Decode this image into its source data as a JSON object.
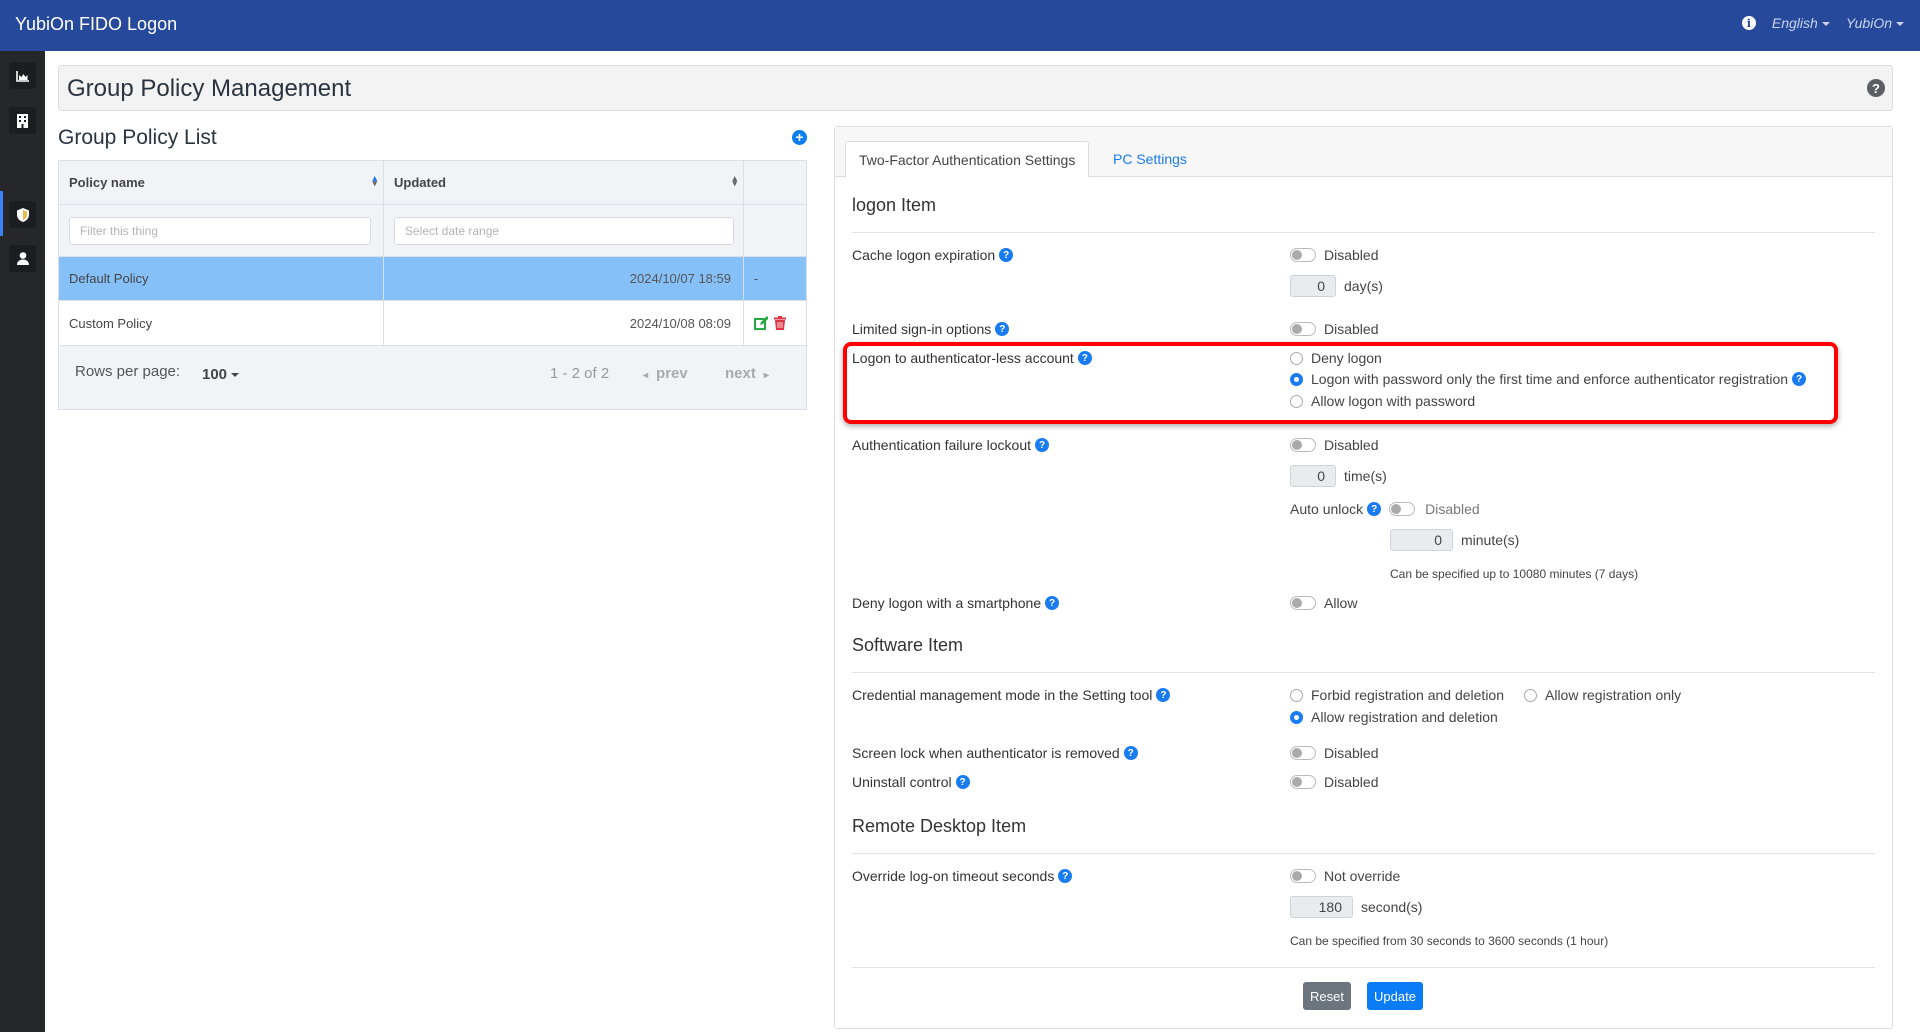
{
  "header": {
    "app_title": "YubiOn FIDO Logon",
    "language": "English",
    "user": "YubiOn",
    "info_icon": "info-circle-icon"
  },
  "sidebar": {
    "items": [
      {
        "icon": "chart-area-icon",
        "label": "Dashboard"
      },
      {
        "icon": "building-icon",
        "label": "Organization"
      },
      {
        "icon": "shield-icon",
        "label": "Group Policy",
        "active": true
      },
      {
        "icon": "user-icon",
        "label": "Users"
      }
    ]
  },
  "page": {
    "title": "Group Policy Management",
    "help_icon": "question-circle-icon"
  },
  "policy_list": {
    "title": "Group Policy List",
    "add_icon": "plus-circle-icon",
    "columns": [
      "Policy name",
      "Updated",
      ""
    ],
    "filter_placeholder": "Filter this thing",
    "date_placeholder": "Select date range",
    "rows": [
      {
        "name": "Default Policy",
        "updated": "2024/10/07 18:59",
        "actions": "-",
        "selected": true
      },
      {
        "name": "Custom Policy",
        "updated": "2024/10/08 08:09",
        "actions": "edit-delete",
        "selected": false
      }
    ],
    "footer": {
      "rows_per_page_label": "Rows per page:",
      "rows_per_page_value": "100",
      "range_info": "1 - 2 of 2",
      "prev_label": "prev",
      "next_label": "next"
    }
  },
  "settings": {
    "tabs": [
      {
        "label": "Two-Factor Authentication Settings",
        "active": true
      },
      {
        "label": "PC Settings",
        "active": false
      }
    ],
    "logon_section": {
      "title": "logon Item",
      "cache_logon": {
        "label": "Cache logon expiration",
        "toggle_state": "Disabled",
        "value": "0",
        "unit": "day(s)"
      },
      "limited_signin": {
        "label": "Limited sign-in options",
        "toggle_state": "Disabled"
      },
      "authless_account": {
        "label": "Logon to authenticator-less account",
        "options": [
          {
            "label": "Deny logon",
            "checked": false
          },
          {
            "label": "Logon with password only the first time and enforce authenticator registration",
            "checked": true
          },
          {
            "label": "Allow logon with password",
            "checked": false
          }
        ]
      },
      "failure_lockout": {
        "label": "Authentication failure lockout",
        "toggle_state": "Disabled",
        "value": "0",
        "unit": "time(s)",
        "auto_unlock_label": "Auto unlock",
        "auto_unlock_state": "Disabled",
        "auto_unlock_value": "0",
        "auto_unlock_unit": "minute(s)",
        "note": "Can be specified up to 10080 minutes (7 days)"
      },
      "deny_smartphone": {
        "label": "Deny logon with a smartphone",
        "toggle_state": "Allow"
      }
    },
    "software_section": {
      "title": "Software Item",
      "credential_mode": {
        "label": "Credential management mode in the Setting tool",
        "options": [
          {
            "label": "Forbid registration and deletion",
            "checked": false
          },
          {
            "label": "Allow registration only",
            "checked": false
          },
          {
            "label": "Allow registration and deletion",
            "checked": true
          }
        ]
      },
      "screen_lock": {
        "label": "Screen lock when authenticator is removed",
        "toggle_state": "Disabled"
      },
      "uninstall": {
        "label": "Uninstall control",
        "toggle_state": "Disabled"
      }
    },
    "remote_section": {
      "title": "Remote Desktop Item",
      "timeout": {
        "label": "Override log-on timeout seconds",
        "toggle_state": "Not override",
        "value": "180",
        "unit": "second(s)",
        "note": "Can be specified from 30 seconds to 3600 seconds (1 hour)"
      }
    },
    "buttons": {
      "reset": "Reset",
      "update": "Update"
    },
    "colors": {
      "accent": "#1a7cf2",
      "header": "#26499c",
      "highlight": "#ff0000",
      "selected_row": "#85c0f8"
    }
  }
}
